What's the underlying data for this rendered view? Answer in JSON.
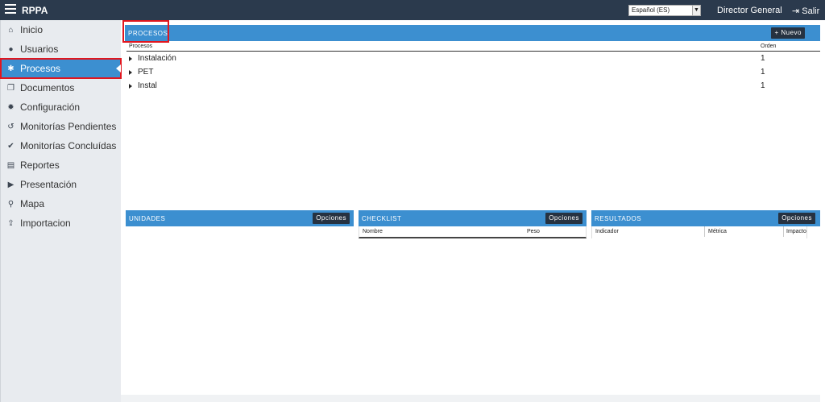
{
  "topbar": {
    "app_title": "RPPA",
    "menu_icon": "hamburger-icon",
    "language": "Español (ES)",
    "user": "Director General",
    "logout_label": "Salir",
    "logout_icon": "sign-out-icon"
  },
  "sidebar": {
    "items": [
      {
        "label": "Inicio",
        "icon": "home-icon"
      },
      {
        "label": "Usuarios",
        "icon": "user-icon"
      },
      {
        "label": "Procesos",
        "icon": "gears-icon"
      },
      {
        "label": "Documentos",
        "icon": "documents-icon"
      },
      {
        "label": "Configuración",
        "icon": "gear-icon"
      },
      {
        "label": "Monitorías Pendientes",
        "icon": "history-icon"
      },
      {
        "label": "Monitorías Concluídas",
        "icon": "check-circle-icon"
      },
      {
        "label": "Reportes",
        "icon": "file-icon"
      },
      {
        "label": "Presentación",
        "icon": "play-icon"
      },
      {
        "label": "Mapa",
        "icon": "map-marker-icon"
      },
      {
        "label": "Importacion",
        "icon": "upload-icon"
      }
    ]
  },
  "procesos": {
    "title": "PROCESOS",
    "new_button": "+ Nuevo",
    "columns": [
      "Procesos",
      "Orden"
    ],
    "rows": [
      {
        "name": "Instalación",
        "order": "1"
      },
      {
        "name": "PET",
        "order": "1"
      },
      {
        "name": "Instal",
        "order": "1"
      }
    ]
  },
  "unidades": {
    "title": "UNIDADES",
    "options_button": "Opciones"
  },
  "checklist": {
    "title": "CHECKLIST",
    "options_button": "Opciones",
    "columns": [
      "Nombre",
      "Peso"
    ]
  },
  "resultados": {
    "title": "RESULTADOS",
    "options_button": "Opciones",
    "columns": [
      "Indicador",
      "Métrica",
      "Impacto"
    ]
  },
  "colors": {
    "header": "#2b3a4d",
    "accent": "#3c8fd0",
    "highlight": "#e0161f"
  }
}
